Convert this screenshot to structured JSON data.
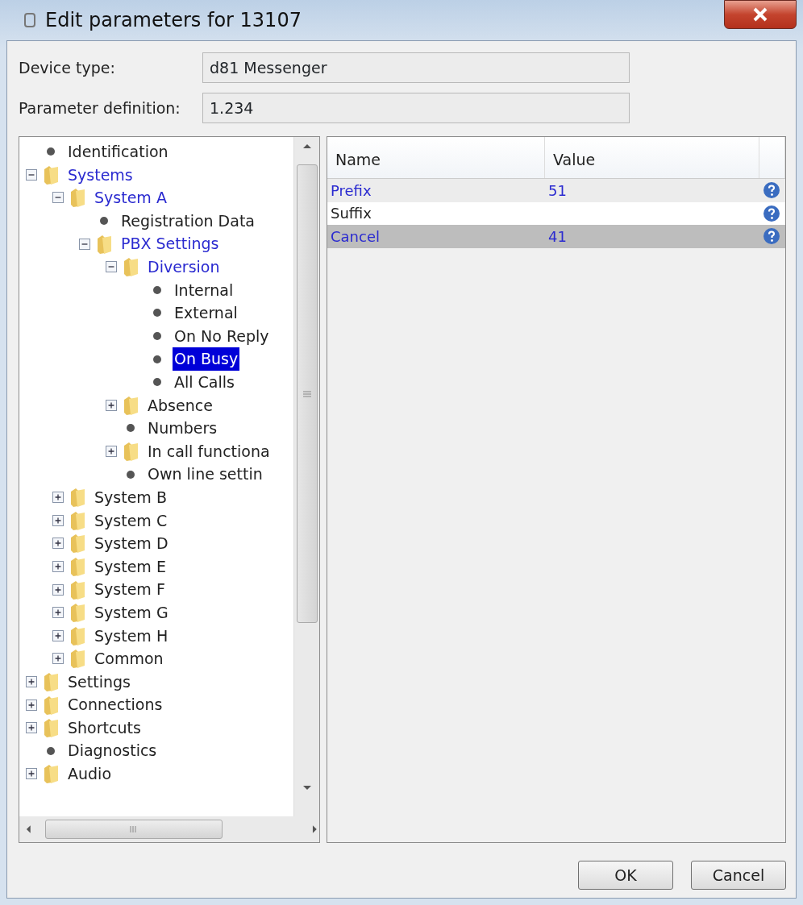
{
  "window": {
    "title": "Edit parameters for 13107"
  },
  "fields": [
    {
      "label": "Device type:",
      "value": "d81 Messenger"
    },
    {
      "label": "Parameter definition:",
      "value": "1.234"
    }
  ],
  "tree": [
    {
      "label": "Identification",
      "kind": "leaf",
      "selected": false
    },
    {
      "label": "Systems",
      "kind": "folder",
      "expanded": true,
      "selected": false,
      "children": [
        {
          "label": "System A",
          "kind": "folder",
          "expanded": true,
          "selected": false,
          "children": [
            {
              "label": "Registration Data",
              "kind": "leaf",
              "selected": false
            },
            {
              "label": "PBX Settings",
              "kind": "folder",
              "expanded": true,
              "selected": false,
              "children": [
                {
                  "label": "Diversion",
                  "kind": "folder",
                  "expanded": true,
                  "selected": false,
                  "children": [
                    {
                      "label": "Internal",
                      "kind": "leaf",
                      "selected": false
                    },
                    {
                      "label": "External",
                      "kind": "leaf",
                      "selected": false
                    },
                    {
                      "label": "On No Reply",
                      "kind": "leaf",
                      "selected": false
                    },
                    {
                      "label": "On Busy",
                      "kind": "leaf",
                      "selected": true
                    },
                    {
                      "label": "All Calls",
                      "kind": "leaf",
                      "selected": false
                    }
                  ]
                },
                {
                  "label": "Absence",
                  "kind": "folder",
                  "expanded": false,
                  "selected": false
                },
                {
                  "label": "Numbers",
                  "kind": "leaf",
                  "selected": false
                },
                {
                  "label": "In call functiona",
                  "kind": "folder",
                  "expanded": false,
                  "selected": false
                },
                {
                  "label": "Own line settin",
                  "kind": "leaf",
                  "selected": false
                }
              ]
            }
          ]
        },
        {
          "label": "System B",
          "kind": "folder",
          "expanded": false,
          "selected": false
        },
        {
          "label": "System C",
          "kind": "folder",
          "expanded": false,
          "selected": false
        },
        {
          "label": "System D",
          "kind": "folder",
          "expanded": false,
          "selected": false
        },
        {
          "label": "System E",
          "kind": "folder",
          "expanded": false,
          "selected": false
        },
        {
          "label": "System F",
          "kind": "folder",
          "expanded": false,
          "selected": false
        },
        {
          "label": "System G",
          "kind": "folder",
          "expanded": false,
          "selected": false
        },
        {
          "label": "System H",
          "kind": "folder",
          "expanded": false,
          "selected": false
        },
        {
          "label": "Common",
          "kind": "folder",
          "expanded": false,
          "selected": false
        }
      ]
    },
    {
      "label": "Settings",
      "kind": "folder",
      "expanded": false,
      "selected": false
    },
    {
      "label": "Connections",
      "kind": "folder",
      "expanded": false,
      "selected": false
    },
    {
      "label": "Shortcuts",
      "kind": "folder",
      "expanded": false,
      "selected": false
    },
    {
      "label": "Diagnostics",
      "kind": "leaf",
      "selected": false
    },
    {
      "label": "Audio",
      "kind": "folder",
      "expanded": false,
      "selected": false
    }
  ],
  "table": {
    "columns": [
      "Name",
      "Value"
    ],
    "rows": [
      {
        "name": "Prefix",
        "value": "51",
        "modified": true,
        "selected": false
      },
      {
        "name": "Suffix",
        "modified": false,
        "selected": false
      },
      {
        "name": "Cancel",
        "value": "41",
        "modified": true,
        "selected": true
      }
    ]
  },
  "buttons": [
    "OK",
    "Cancel"
  ]
}
